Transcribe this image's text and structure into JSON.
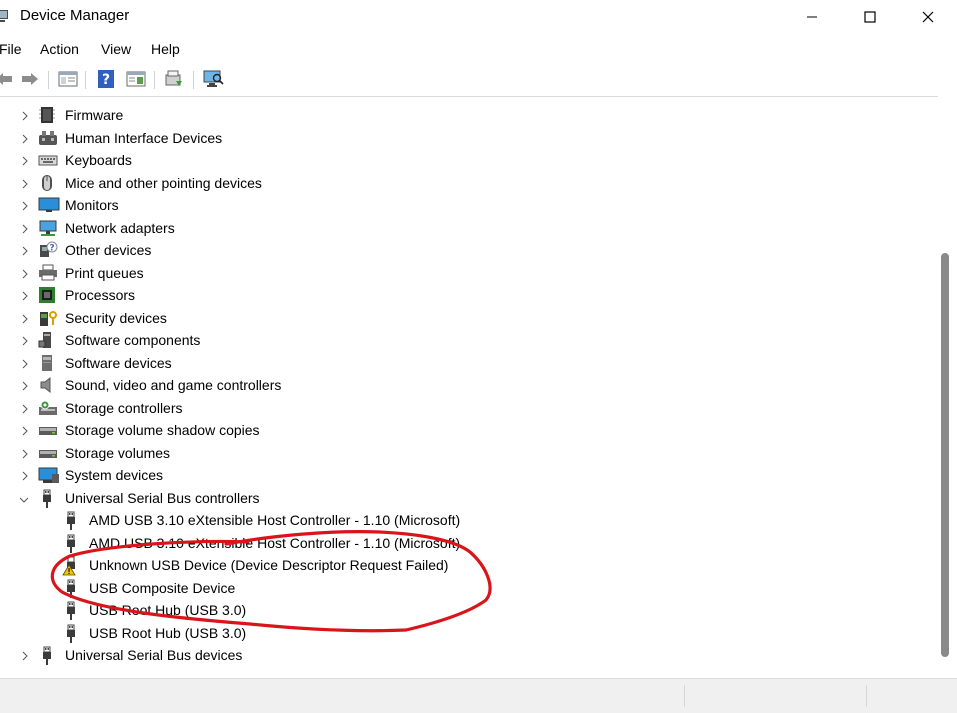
{
  "window": {
    "title": "Device Manager",
    "minimize_icon": "minimize-icon",
    "maximize_icon": "maximize-icon",
    "close_icon": "close-icon"
  },
  "menu": [
    "File",
    "Action",
    "View",
    "Help"
  ],
  "toolbar": [
    "back-arrow-icon",
    "forward-arrow-icon",
    "properties-icon",
    "help-icon",
    "view-icon",
    "update-driver-icon",
    "scan-hardware-icon"
  ],
  "tree": {
    "categories": [
      {
        "label": "Firmware",
        "icon": "chip-icon",
        "expanded": false
      },
      {
        "label": "Human Interface Devices",
        "icon": "hid-icon",
        "expanded": false
      },
      {
        "label": "Keyboards",
        "icon": "keyboard-icon",
        "expanded": false
      },
      {
        "label": "Mice and other pointing devices",
        "icon": "mouse-icon",
        "expanded": false
      },
      {
        "label": "Monitors",
        "icon": "monitor-icon",
        "expanded": false
      },
      {
        "label": "Network adapters",
        "icon": "network-icon",
        "expanded": false
      },
      {
        "label": "Other devices",
        "icon": "unknown-device-icon",
        "expanded": false
      },
      {
        "label": "Print queues",
        "icon": "printer-icon",
        "expanded": false
      },
      {
        "label": "Processors",
        "icon": "processor-icon",
        "expanded": false
      },
      {
        "label": "Security devices",
        "icon": "security-icon",
        "expanded": false
      },
      {
        "label": "Software components",
        "icon": "software-component-icon",
        "expanded": false
      },
      {
        "label": "Software devices",
        "icon": "software-device-icon",
        "expanded": false
      },
      {
        "label": "Sound, video and game controllers",
        "icon": "speaker-icon",
        "expanded": false
      },
      {
        "label": "Storage controllers",
        "icon": "storage-controller-icon",
        "expanded": false
      },
      {
        "label": "Storage volume shadow copies",
        "icon": "drive-icon",
        "expanded": false
      },
      {
        "label": "Storage volumes",
        "icon": "drive-icon",
        "expanded": false
      },
      {
        "label": "System devices",
        "icon": "system-icon",
        "expanded": false
      },
      {
        "label": "Universal Serial Bus controllers",
        "icon": "usb-icon",
        "expanded": true
      },
      {
        "label": "Universal Serial Bus devices",
        "icon": "usb-icon",
        "expanded": false
      }
    ],
    "usb_children": [
      {
        "label": "AMD USB 3.10 eXtensible Host Controller - 1.10 (Microsoft)",
        "icon": "usb-icon",
        "warning": false
      },
      {
        "label": "AMD USB 3.10 eXtensible Host Controller - 1.10 (Microsoft)",
        "icon": "usb-icon",
        "warning": false
      },
      {
        "label": "Unknown USB Device (Device Descriptor Request Failed)",
        "icon": "usb-warning-icon",
        "warning": true
      },
      {
        "label": "USB Composite Device",
        "icon": "usb-icon",
        "warning": false
      },
      {
        "label": "USB Root Hub (USB 3.0)",
        "icon": "usb-icon",
        "warning": false
      },
      {
        "label": "USB Root Hub (USB 3.0)",
        "icon": "usb-icon",
        "warning": false
      }
    ]
  },
  "colors": {
    "annotation": "#d9141b",
    "warning": "#f5c400",
    "monitor": "#2a8fd9",
    "scroll_thumb": "#8a8a8a"
  }
}
